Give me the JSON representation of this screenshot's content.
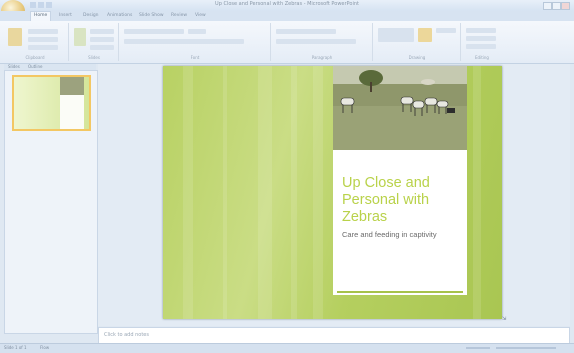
{
  "app": {
    "title": "Up Close and Personal with Zebras - Microsoft PowerPoint"
  },
  "ribbon": {
    "tabs": [
      "Home",
      "Insert",
      "Design",
      "Animations",
      "Slide Show",
      "Review",
      "View"
    ],
    "active_tab": "Home",
    "groups": [
      "Clipboard",
      "Slides",
      "Font",
      "Paragraph",
      "Drawing",
      "Editing"
    ]
  },
  "panes": {
    "tabs": [
      "Slides",
      "Outline"
    ]
  },
  "slide": {
    "title": "Up Close and Personal with Zebras",
    "subtitle": "Care and feeding in captivity"
  },
  "notes": {
    "placeholder": "Click to add notes"
  },
  "statusbar": {
    "slide_info": "Slide 1 of 1",
    "theme": "Flow",
    "zoom": ""
  },
  "colors": {
    "accent_green": "#b9d24a",
    "slide_bg": "#c3d777",
    "ribbon_bg": "#e4ecf6"
  }
}
